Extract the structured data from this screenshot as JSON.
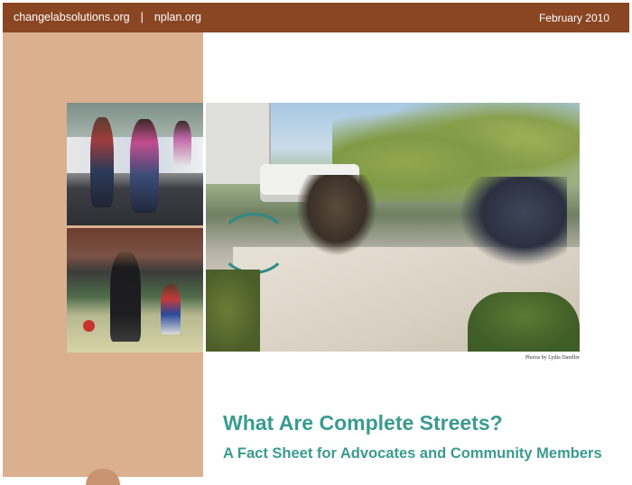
{
  "header": {
    "site1": "changelabsolutions.org",
    "separator": "|",
    "site2": "nplan.org",
    "date": "February 2010"
  },
  "photos": {
    "credit": "Photos by Lydia Daniller"
  },
  "document": {
    "title": "What Are Complete Streets?",
    "subtitle": "A Fact Sheet for Advocates and Community Members"
  },
  "colors": {
    "header_bar": "#8a4522",
    "side_panel": "#dbb08f",
    "title_teal": "#3a9b8f"
  }
}
